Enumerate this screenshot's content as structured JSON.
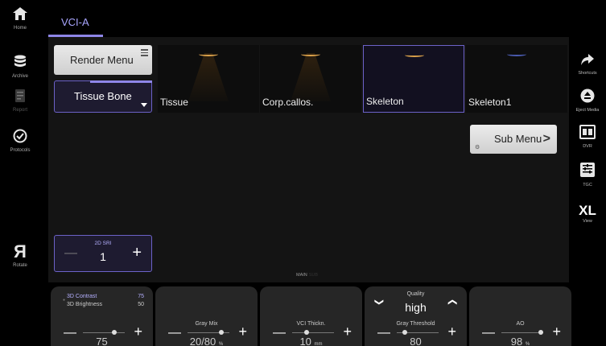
{
  "left_rail": [
    {
      "label": "Home",
      "icon": "home-icon",
      "dim": false
    },
    {
      "label": "Archive",
      "icon": "database-icon",
      "dim": false
    },
    {
      "label": "Report",
      "icon": "report-icon",
      "dim": true
    },
    {
      "label": "Protocols",
      "icon": "check-circle-icon",
      "dim": false
    },
    {
      "label": "Rotate",
      "icon": "rotate-icon",
      "dim": false
    }
  ],
  "right_rail": [
    {
      "label": "Shortcuts",
      "icon": "share-arrow-icon"
    },
    {
      "label": "Eject Media",
      "icon": "eject-icon"
    },
    {
      "label": "DVR",
      "icon": "dvr-icon"
    },
    {
      "label": "TGC",
      "icon": "tgc-icon"
    },
    {
      "label": "View",
      "glyph": "XL",
      "icon": "xl-view-icon"
    }
  ],
  "tab": {
    "label": "VCI-A"
  },
  "render_menu": {
    "label": "Render Menu"
  },
  "tissue_bone": {
    "label": "Tissue Bone"
  },
  "presets": [
    {
      "label": "Tissue",
      "selected": false,
      "arc_color": "#d9a04a"
    },
    {
      "label": "Corp.callos.",
      "selected": false,
      "arc_color": "#d9a04a"
    },
    {
      "label": "Skeleton",
      "selected": true,
      "arc_color": "#d9a04a"
    },
    {
      "label": "Skeleton1",
      "selected": false,
      "arc_color": "#4a5bb0"
    }
  ],
  "sub_menu": {
    "label": "Sub Menu"
  },
  "sri": {
    "label": "2D SRI",
    "value": "1"
  },
  "main_label": {
    "main": "MAIN",
    "alt": "SUB"
  },
  "knobs": {
    "contrast": {
      "line1_label": "3D Contrast",
      "line1_value": "75",
      "line2_label": "3D Brightness",
      "line2_value": "50",
      "value": "75",
      "level": 0.75
    },
    "gray_mix": {
      "title": "Gray Mix",
      "value": "20/80",
      "unit": "%",
      "level": 0.8
    },
    "vci_thickness": {
      "title": "VCI Thickn.",
      "value": "10",
      "unit": "mm",
      "level": 0.35
    },
    "quality": {
      "title": "Quality",
      "value": "high"
    },
    "gray_threshold": {
      "title": "Gray Threshold",
      "value": "80",
      "level": 0.2
    },
    "ao": {
      "title": "AO",
      "value": "98",
      "unit": "%",
      "level": 0.95
    }
  },
  "colors": {
    "accent": "#8e86e8",
    "accent_text": "#a9a6ff",
    "background": "#000000",
    "panel": "#141414"
  }
}
